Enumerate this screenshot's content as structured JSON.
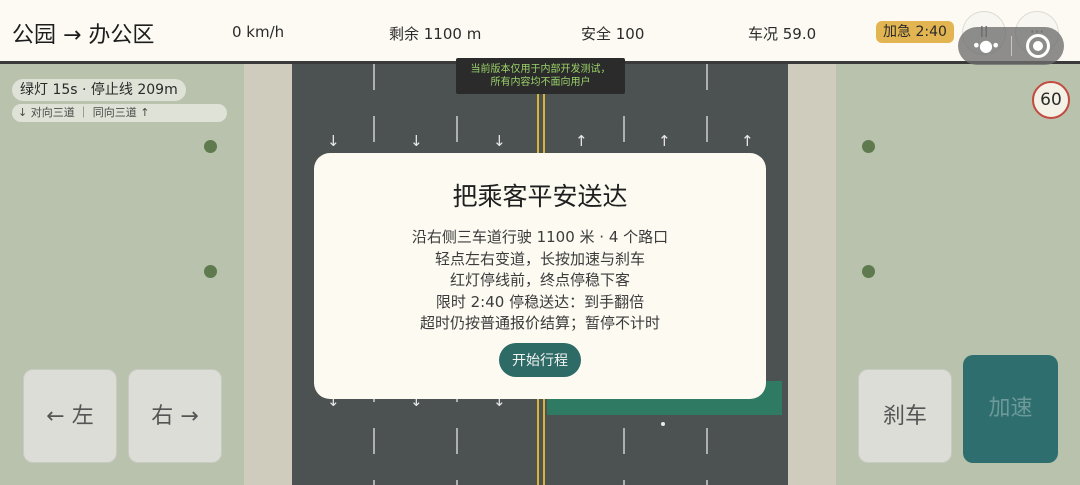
{
  "topbar": {
    "route": "公园 → 办公区",
    "speed": "0 km/h",
    "remaining": "剩余 1100 m",
    "safety": "安全 100",
    "car_condition": "车况 59.0",
    "rush_badge": "加急 2:40",
    "pause_icon": "pause-icon",
    "more_icon": "more-icon"
  },
  "dev_notice": {
    "line1": "当前版本仅用于内部开发测试，",
    "line2": "所有内容均不面向用户"
  },
  "hud": {
    "signal": "绿灯 15s · 停止线 209m",
    "lanes": "↓ 对向三道 ｜ 同向三道 ↑",
    "speed_limit": "60"
  },
  "controls": {
    "left": "← 左",
    "right": "右 →",
    "brake": "刹车",
    "accelerate": "加速"
  },
  "modal": {
    "title": "把乘客平安送达",
    "lines": [
      "沿右侧三车道行驶 1100 米 · 4 个路口",
      "轻点左右变道，长按加速与刹车",
      "红灯停线前，终点停稳下客",
      "限时 2:40 停稳送达：到手翻倍",
      "超时仍按普通报价结算；暂停不计时"
    ],
    "start_button": "开始行程"
  },
  "colors": {
    "accent": "#2f6b66",
    "badge": "#e2b552",
    "road": "#4c5151",
    "grass": "#b9c2ac"
  }
}
